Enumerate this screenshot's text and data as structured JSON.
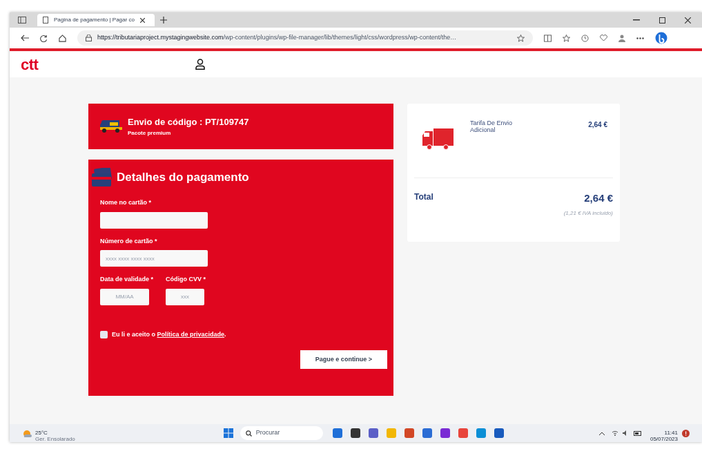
{
  "browser": {
    "tab_title": "Pagina de pagamento | Pagar co",
    "url_host": "https://tributariaproject.mystagingwebsite.com",
    "url_path": "/wp-content/plugins/wp-file-manager/lib/themes/light/css/wordpress/wp-content/the…"
  },
  "site": {
    "logo": "ctt"
  },
  "shipment": {
    "title": "Envio de código : PT/109747",
    "subtitle": "Pacote premium"
  },
  "payment": {
    "title": "Detalhes do pagamento",
    "fields": [
      {
        "label": "Nome no cartão *"
      },
      {
        "label": "Número de cartão *",
        "placeholder": "xxxx xxxx xxxx xxxx"
      },
      {
        "label": "Data de validade *",
        "placeholder": "MM/AA"
      },
      {
        "label": "Código CVV *",
        "placeholder": "xxx"
      }
    ],
    "consent": {
      "text": "Eu li e aceito o",
      "link": "Política de privacidade",
      "end": ".",
      "checked": false
    },
    "button": "Pague e continue >"
  },
  "summary": {
    "item": "Tarifa De Envio Adicional",
    "item_price": "2,64 €",
    "total_label": "Total",
    "total": "2,64 €",
    "tax_note": "(1,21 € IVA incluido)"
  },
  "taskbar": {
    "temperature": "25°C",
    "weather": "Ger. Ensolarado",
    "search": "Procurar",
    "time": "11:41",
    "date": "05/07/2023"
  }
}
